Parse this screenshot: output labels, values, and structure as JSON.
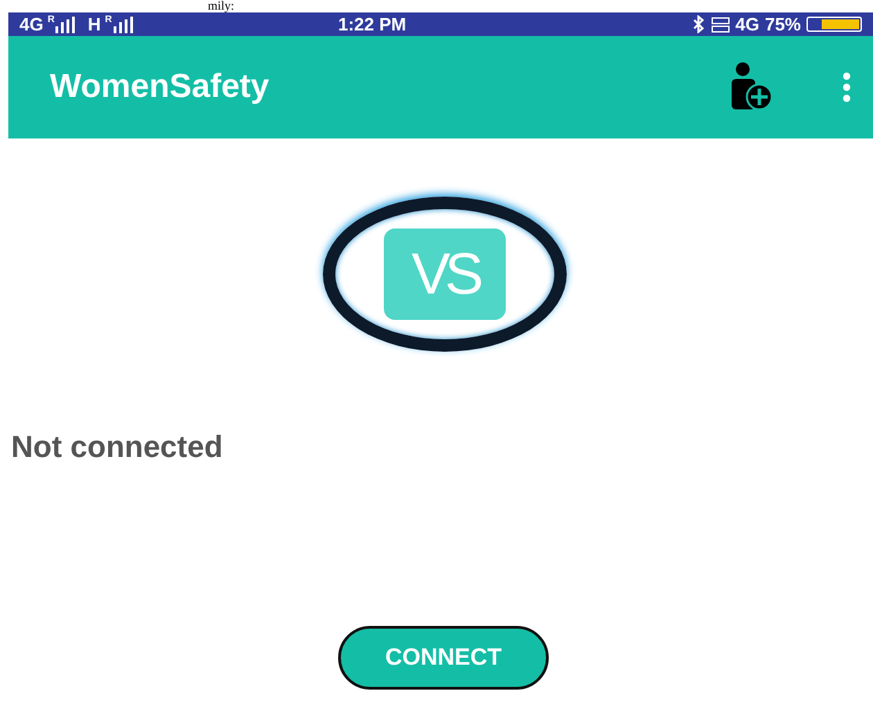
{
  "caption_fragment": "mily:",
  "status_bar": {
    "network_1": "4G",
    "roaming_1": "R",
    "network_2": "H",
    "roaming_2": "R",
    "time": "1:22 PM",
    "network_3": "4G",
    "battery": "75%"
  },
  "app_bar": {
    "title": "WomenSafety"
  },
  "logo": {
    "text": "VS"
  },
  "status_text": "Not connected",
  "connect_button": {
    "label": "CONNECT"
  }
}
